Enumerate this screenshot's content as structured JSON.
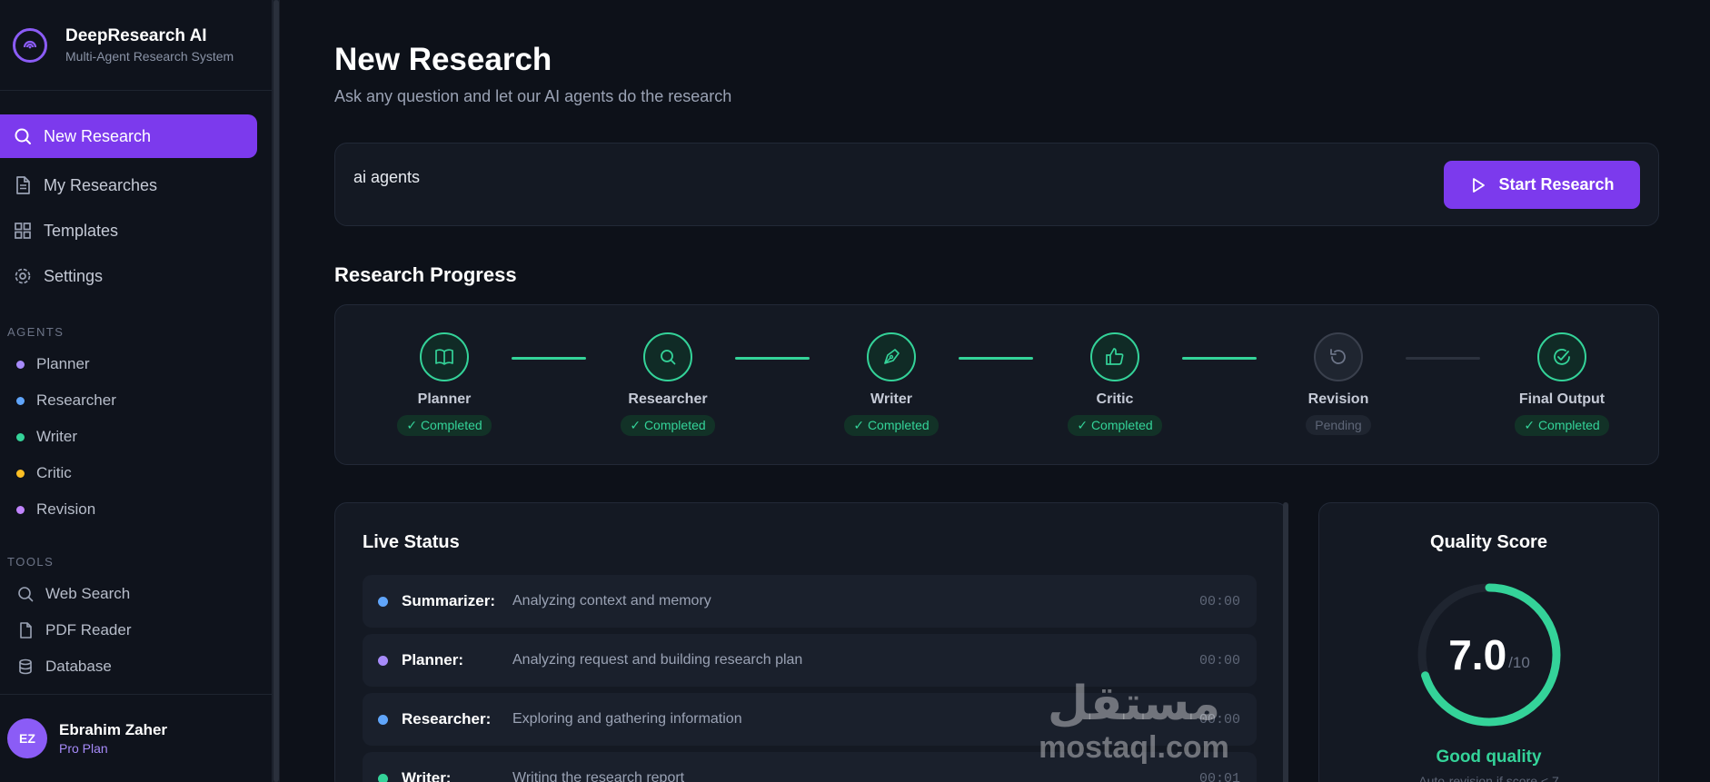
{
  "brand": {
    "title": "DeepResearch AI",
    "subtitle": "Multi-Agent Research System",
    "accent": "#7c3aed"
  },
  "nav": {
    "items": [
      {
        "label": "New Research",
        "icon": "search-icon",
        "active": true
      },
      {
        "label": "My Researches",
        "icon": "document-icon",
        "active": false
      },
      {
        "label": "Templates",
        "icon": "grid-icon",
        "active": false
      },
      {
        "label": "Settings",
        "icon": "gear-icon",
        "active": false
      }
    ]
  },
  "agents": {
    "heading": "AGENTS",
    "items": [
      {
        "label": "Planner",
        "color": "#a78bfa"
      },
      {
        "label": "Researcher",
        "color": "#60a5fa"
      },
      {
        "label": "Writer",
        "color": "#34d399"
      },
      {
        "label": "Critic",
        "color": "#fbbf24"
      },
      {
        "label": "Revision",
        "color": "#c084fc"
      }
    ]
  },
  "tools": {
    "heading": "TOOLS",
    "items": [
      {
        "label": "Web Search",
        "icon": "search-icon"
      },
      {
        "label": "PDF Reader",
        "icon": "file-icon"
      },
      {
        "label": "Database",
        "icon": "database-icon"
      }
    ]
  },
  "user": {
    "initials": "EZ",
    "name": "Ebrahim Zaher",
    "plan": "Pro Plan"
  },
  "header": {
    "title": "New Research",
    "subtitle": "Ask any question and let our AI agents do the research"
  },
  "query": {
    "value": "ai agents",
    "button_label": "Start Research"
  },
  "progress": {
    "title": "Research Progress",
    "steps": [
      {
        "name": "Planner",
        "status": "✓ Completed",
        "icon": "book-icon",
        "state": "completed"
      },
      {
        "name": "Researcher",
        "status": "✓ Completed",
        "icon": "search-icon",
        "state": "completed"
      },
      {
        "name": "Writer",
        "status": "✓ Completed",
        "icon": "pen-icon",
        "state": "completed"
      },
      {
        "name": "Critic",
        "status": "✓ Completed",
        "icon": "thumbs-up-icon",
        "state": "completed"
      },
      {
        "name": "Revision",
        "status": "Pending",
        "icon": "refresh-icon",
        "state": "pending"
      },
      {
        "name": "Final Output",
        "status": "✓ Completed",
        "icon": "check-circle-icon",
        "state": "completed"
      }
    ]
  },
  "live_status": {
    "title": "Live Status",
    "rows": [
      {
        "agent": "Summarizer:",
        "text": "Analyzing context and memory",
        "time": "00:00",
        "color": "#60a5fa"
      },
      {
        "agent": "Planner:",
        "text": "Analyzing request and building research plan",
        "time": "00:00",
        "color": "#a78bfa"
      },
      {
        "agent": "Researcher:",
        "text": "Exploring and gathering information",
        "time": "00:00",
        "color": "#60a5fa"
      },
      {
        "agent": "Writer:",
        "text": "Writing the research report",
        "time": "00:01",
        "color": "#34d399"
      }
    ]
  },
  "quality": {
    "title": "Quality Score",
    "score": "7.0",
    "max": "/10",
    "fraction": 0.7,
    "label": "Good quality",
    "note": "Auto-revision if score < 7"
  },
  "watermark": {
    "arabic": "مستقل",
    "latin": "mostaql.com"
  }
}
